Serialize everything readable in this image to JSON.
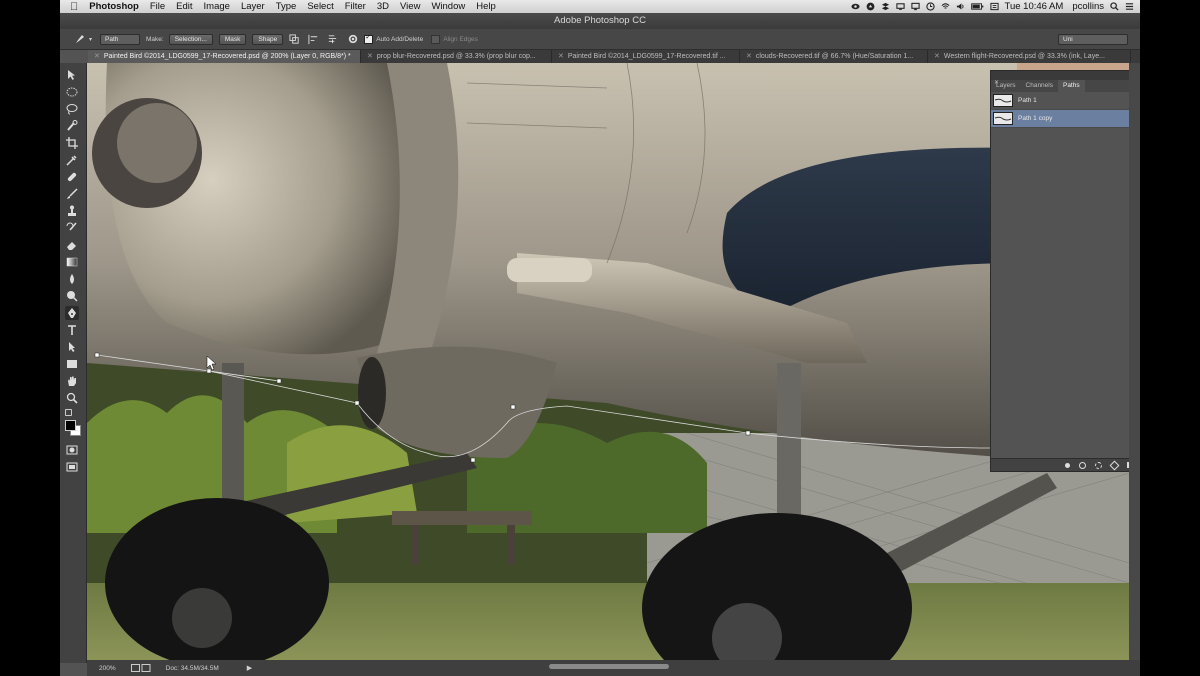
{
  "menubar": {
    "app": "Photoshop",
    "items": [
      "File",
      "Edit",
      "Image",
      "Layer",
      "Type",
      "Select",
      "Filter",
      "3D",
      "View",
      "Window",
      "Help"
    ],
    "clock": "Tue 10:46 AM",
    "user": "pcollins"
  },
  "window": {
    "title": "Adobe Photoshop CC"
  },
  "options": {
    "mode": "Path",
    "make_label": "Make:",
    "selection_btn": "Selection...",
    "mask_btn": "Mask",
    "shape_btn": "Shape",
    "auto_add_delete": "Auto Add/Delete",
    "align_edges": "Align Edges",
    "workspace": "Uni"
  },
  "tabs": [
    {
      "label": "Painted Bird ©2014_LDG0599_17-Recovered.psd @ 200% (Layer 0, RGB/8*) *"
    },
    {
      "label": "prop blur-Recovered.psd @ 33.3% (prop blur cop..."
    },
    {
      "label": "Painted Bird ©2014_LDG0599_17-Recovered.tif ..."
    },
    {
      "label": "clouds-Recovered.tif @ 66.7% (Hue/Saturation 1..."
    },
    {
      "label": "Western flight-Recovered.psd @ 33.3% (ink, Laye..."
    }
  ],
  "panel": {
    "tabs": [
      "Layers",
      "Channels",
      "Paths"
    ],
    "active_tab": "Paths",
    "paths": [
      {
        "name": "Path 1",
        "selected": false
      },
      {
        "name": "Path 1 copy",
        "selected": true
      }
    ]
  },
  "status": {
    "zoom": "200%",
    "doc": "Doc: 34.5M/34.5M"
  },
  "colors": {
    "selection": "#6b7fa0",
    "fg": "#000000",
    "bg": "#ffffff"
  }
}
